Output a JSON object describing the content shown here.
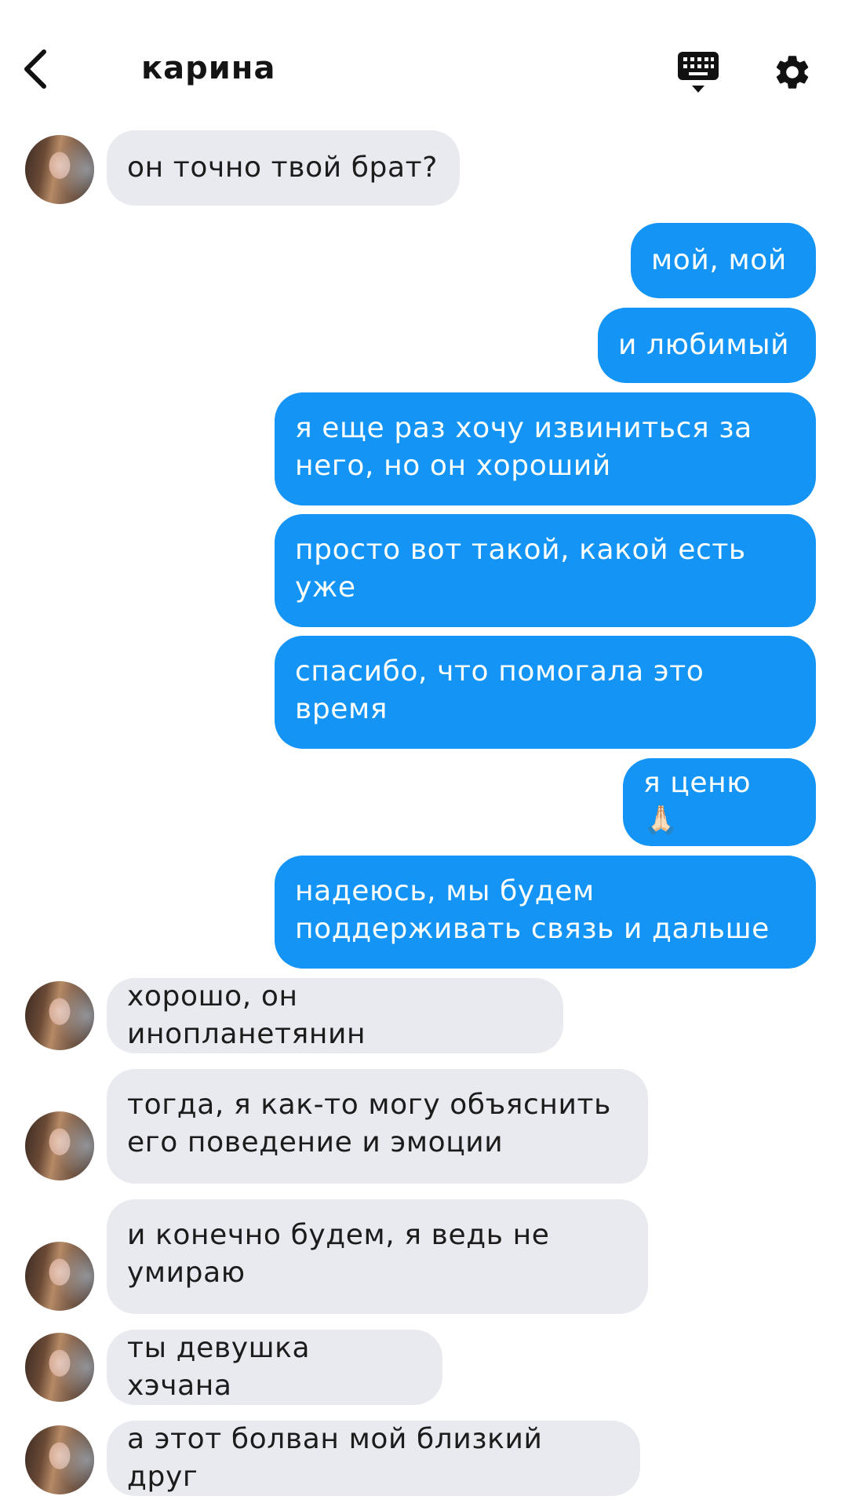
{
  "header": {
    "contact_name": "карина"
  },
  "colors": {
    "outgoing_bubble": "#1495f6",
    "incoming_bubble": "#e9eaf0"
  },
  "messages": [
    {
      "direction": "in",
      "text": "он точно твой брат?"
    },
    {
      "direction": "out",
      "text": "мой, мой"
    },
    {
      "direction": "out",
      "text": "и любимый"
    },
    {
      "direction": "out",
      "text": "я еще раз хочу извиниться за него, но он хороший"
    },
    {
      "direction": "out",
      "text": "просто вот такой, какой есть уже"
    },
    {
      "direction": "out",
      "text": "спасибо, что помогала это время"
    },
    {
      "direction": "out",
      "text": "я ценю 🙏🏻"
    },
    {
      "direction": "out",
      "text": "надеюсь, мы будем поддерживать связь и дальше"
    },
    {
      "direction": "in",
      "text": "хорошо, он инопланетянин"
    },
    {
      "direction": "in",
      "text": "тогда, я как-то могу объяснить его поведение и эмоции"
    },
    {
      "direction": "in",
      "text": "и конечно будем, я ведь не умираю"
    },
    {
      "direction": "in",
      "text": "ты девушка хэчана"
    },
    {
      "direction": "in",
      "text": "а этот болван мой близкий друг"
    }
  ]
}
